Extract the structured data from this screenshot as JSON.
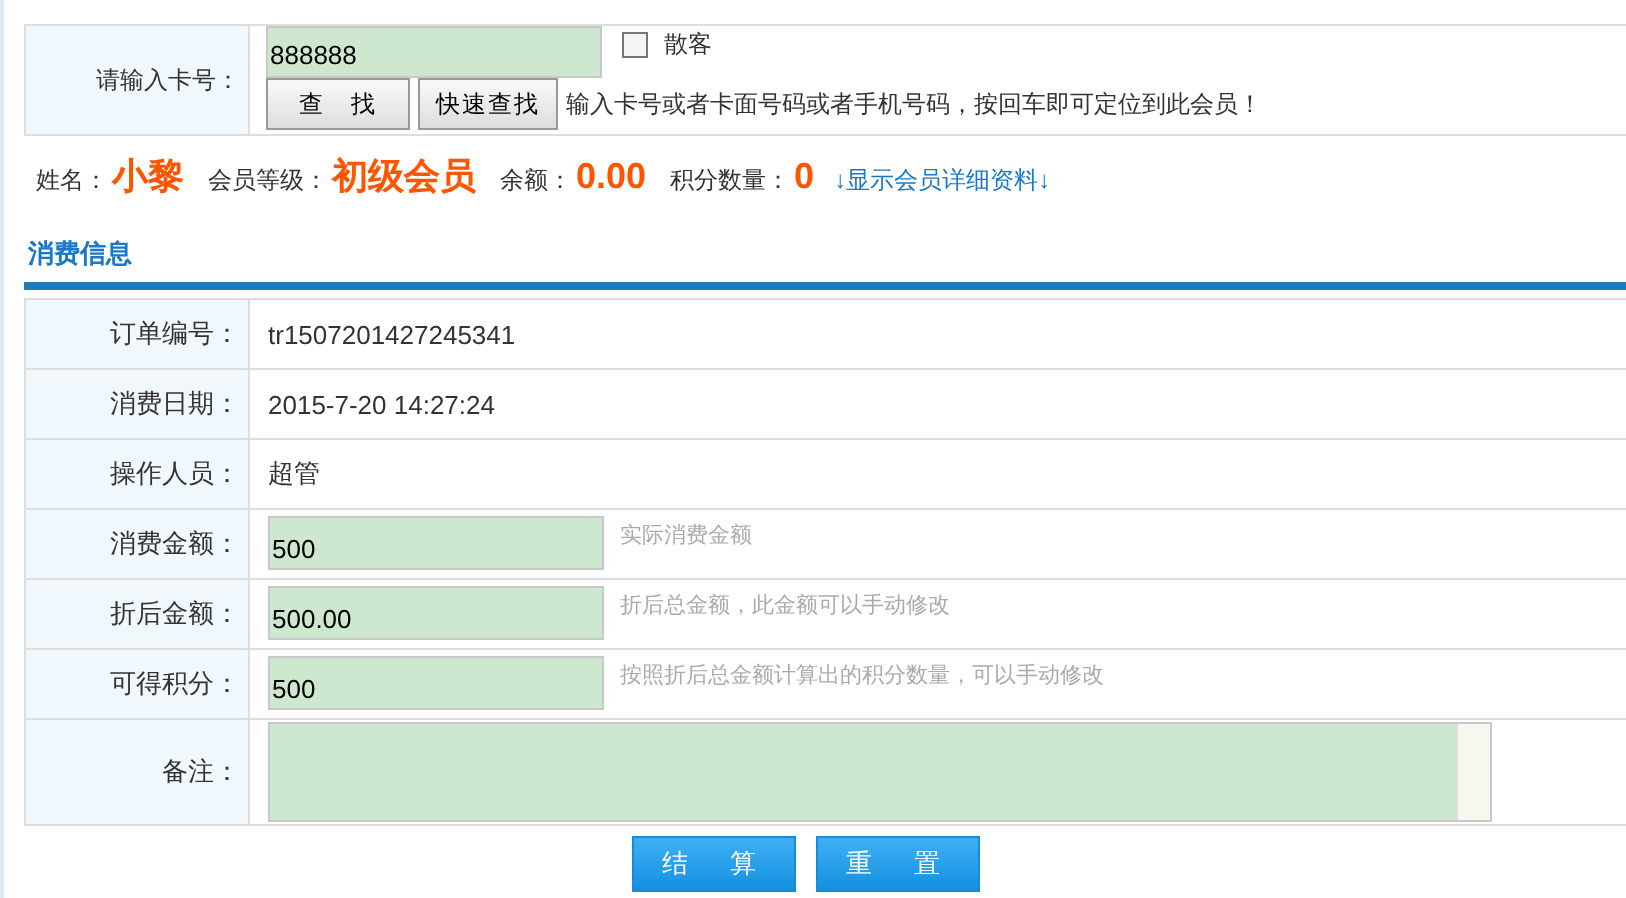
{
  "search": {
    "label": "请输入卡号：",
    "value": "888888",
    "walkin": {
      "label": "散客",
      "checked": false
    },
    "buttons": [
      "查　找",
      "快速查找"
    ],
    "hint": "输入卡号或者卡面号码或者手机号码，按回车即可定位到此会员！"
  },
  "member": [
    {
      "label": "姓名：",
      "value": "小黎"
    },
    {
      "label": "会员等级：",
      "value": "初级会员"
    },
    {
      "label": "余额：",
      "value": "0.00"
    },
    {
      "label": "积分数量：",
      "value": "0"
    }
  ],
  "member_link": "↓显示会员详细资料↓",
  "section_title": "消费信息",
  "rows": [
    {
      "kind": "text",
      "label": "订单编号：",
      "value": "tr1507201427245341"
    },
    {
      "kind": "text",
      "label": "消费日期：",
      "value": "2015-7-20 14:27:24"
    },
    {
      "kind": "text",
      "label": "操作人员：",
      "value": "超管"
    },
    {
      "kind": "input",
      "label": "消费金额：",
      "value": "500",
      "hint": "实际消费金额"
    },
    {
      "kind": "input",
      "label": "折后金额：",
      "value": "500.00",
      "hint": "折后总金额，此金额可以手动修改"
    },
    {
      "kind": "input",
      "label": "可得积分：",
      "value": "500",
      "hint": "按照折后总金额计算出的积分数量，可以手动修改"
    },
    {
      "kind": "textarea",
      "label": "备注："
    }
  ],
  "actions": [
    "结　算",
    "重　置"
  ]
}
